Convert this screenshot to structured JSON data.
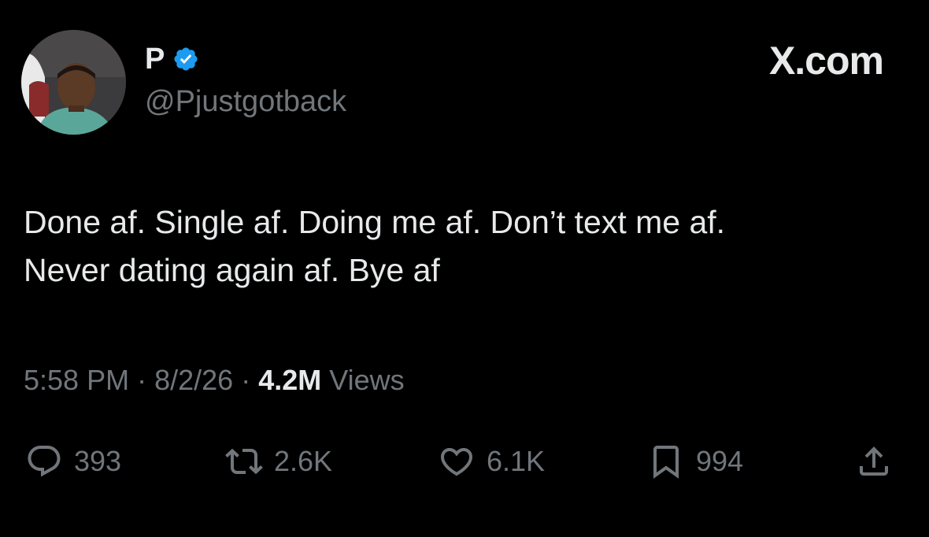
{
  "author": {
    "display_name": "P",
    "handle": "@Pjustgotback",
    "verified_icon": "verified-badge-icon",
    "verified_color": "#1d9bf0"
  },
  "brand": "X.com",
  "tweet": {
    "lines": [
      "Done af. Single af. Doing me af. Don’t text me af.",
      "Never dating again af. Bye af"
    ]
  },
  "meta": {
    "time": "5:58 PM",
    "separator": "·",
    "date": "8/2/26",
    "views_count": "4.2M",
    "views_label": "Views"
  },
  "actions": {
    "replies": "393",
    "reposts": "2.6K",
    "likes": "6.1K",
    "bookmarks": "994"
  },
  "colors": {
    "background": "#000000",
    "text": "#e7e9ea",
    "muted": "#71767b",
    "accent": "#1d9bf0"
  }
}
